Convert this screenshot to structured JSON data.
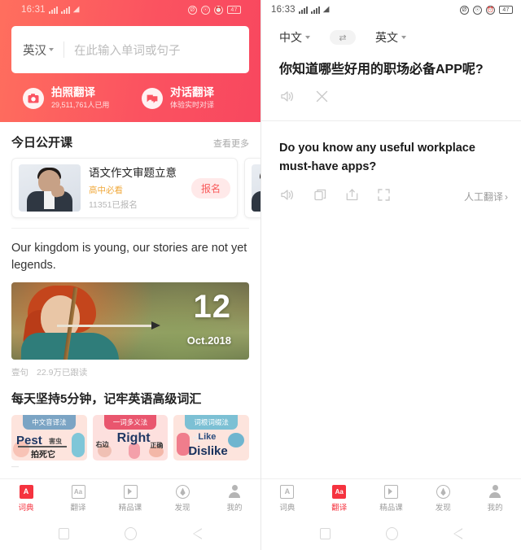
{
  "left": {
    "status": {
      "time": "16:31",
      "battery": "47",
      "icons": [
        "signal-bars",
        "signal-bars",
        "wifi",
        "dnd",
        "lock",
        "alarm",
        "battery"
      ]
    },
    "search": {
      "lang": "英汉",
      "placeholder": "在此输入单词或句子"
    },
    "quick_actions": [
      {
        "icon": "camera-icon",
        "title": "拍照翻译",
        "subtitle": "29,511,761人已用"
      },
      {
        "icon": "chat-icon",
        "title": "对话翻译",
        "subtitle": "体验实时对译"
      }
    ],
    "course_section": {
      "title": "今日公开课",
      "more": "查看更多",
      "card": {
        "title": "语文作文审题立意",
        "tag": "高中必看",
        "count": "11351已报名",
        "button": "报名"
      }
    },
    "quote": {
      "text": "Our kingdom is young, our stories are not yet legends.",
      "day": "12",
      "month_year": "Oct.2018",
      "source": "壹句",
      "reads": "22.9万已跟读"
    },
    "vocab_section": {
      "title": "每天坚持5分钟，记牢英语高级词汇",
      "cards": [
        {
          "tag": "中文音译法",
          "word": "Pest",
          "zh1": "害虫",
          "zh2": "拍死它"
        },
        {
          "tag": "一词多义法",
          "word": "Right",
          "zh1": "右边",
          "zh2": "正确"
        },
        {
          "tag": "词根词缀法",
          "word": "Like",
          "word2": "Dislike",
          "zh1": "",
          "zh2": ""
        }
      ]
    },
    "tabs": [
      {
        "label": "词典",
        "icon": "book-icon",
        "active": true
      },
      {
        "label": "翻译",
        "icon": "aa-icon",
        "active": false
      },
      {
        "label": "精品课",
        "icon": "play-icon",
        "active": false
      },
      {
        "label": "发现",
        "icon": "compass-icon",
        "active": false
      },
      {
        "label": "我的",
        "icon": "user-icon",
        "active": false
      }
    ]
  },
  "right": {
    "status": {
      "time": "16:33",
      "battery": "47"
    },
    "translate": {
      "source_lang": "中文",
      "target_lang": "英文",
      "swap_icon": "swap-icon",
      "source_text": "你知道哪些好用的职场必备APP呢?",
      "source_actions": [
        {
          "icon": "speaker-icon",
          "label": ""
        },
        {
          "icon": "close-icon",
          "label": ""
        }
      ],
      "result_text": "Do you know any useful workplace must-have apps?",
      "result_actions": [
        {
          "icon": "speaker-icon"
        },
        {
          "icon": "copy-icon"
        },
        {
          "icon": "share-icon"
        },
        {
          "icon": "fullscreen-icon"
        }
      ],
      "manual_label": "人工翻译",
      "manual_chevron": "›"
    },
    "tabs": [
      {
        "label": "词典",
        "icon": "book-icon",
        "active": false
      },
      {
        "label": "翻译",
        "icon": "aa-icon",
        "active": true
      },
      {
        "label": "精品课",
        "icon": "play-icon",
        "active": false
      },
      {
        "label": "发现",
        "icon": "compass-icon",
        "active": false
      },
      {
        "label": "我的",
        "icon": "user-icon",
        "active": false
      }
    ]
  },
  "android_nav": [
    {
      "icon": "recents-square-icon"
    },
    {
      "icon": "home-circle-icon"
    },
    {
      "icon": "back-triangle-icon"
    }
  ],
  "colors": {
    "brand_red": "#f5333f",
    "header_left": "#ff6f5e",
    "header_right": "#f8475f",
    "tag_orange": "#f0a93c"
  }
}
